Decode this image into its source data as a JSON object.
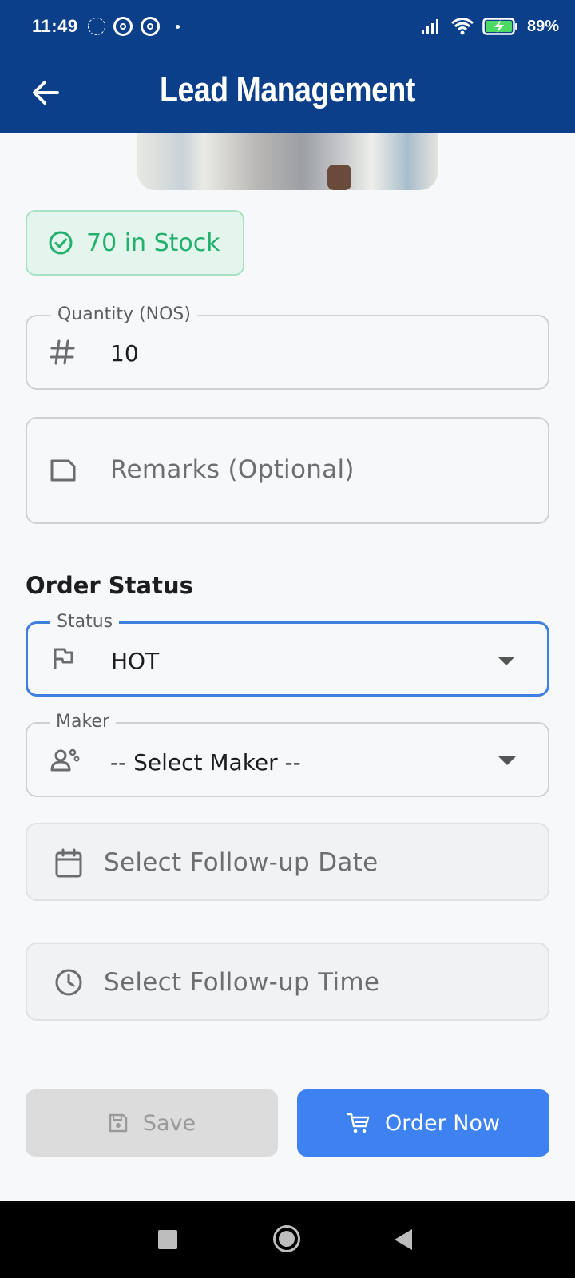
{
  "status_bar": {
    "time": "11:49",
    "battery": "89%",
    "icons": [
      "data-saver-icon",
      "sync-icon",
      "sync-icon",
      "dot-icon",
      "signal-icon",
      "wifi-icon",
      "battery-charging-icon"
    ]
  },
  "app_bar": {
    "title": "Lead Management",
    "back_icon": "arrow-left-icon"
  },
  "stock": {
    "label": "70 in Stock",
    "icon": "check-circle-icon",
    "color": "#22b06e"
  },
  "quantity": {
    "label": "Quantity (NOS)",
    "value": "10",
    "icon": "hash-icon"
  },
  "remarks": {
    "placeholder": "Remarks (Optional)",
    "icon": "note-icon"
  },
  "order_status": {
    "section_title": "Order Status",
    "status": {
      "label": "Status",
      "value": "HOT",
      "icon": "flag-icon"
    },
    "maker": {
      "label": "Maker",
      "value": "-- Select Maker --",
      "icon": "engineer-icon"
    },
    "follow_up_date": {
      "placeholder": "Select Follow-up Date",
      "icon": "calendar-icon"
    },
    "follow_up_time": {
      "placeholder": "Select Follow-up Time",
      "icon": "clock-icon"
    }
  },
  "actions": {
    "save_label": "Save",
    "order_label": "Order Now"
  },
  "colors": {
    "primary": "#0b3f8a",
    "accent": "#3d82f0",
    "success": "#22b06e"
  }
}
